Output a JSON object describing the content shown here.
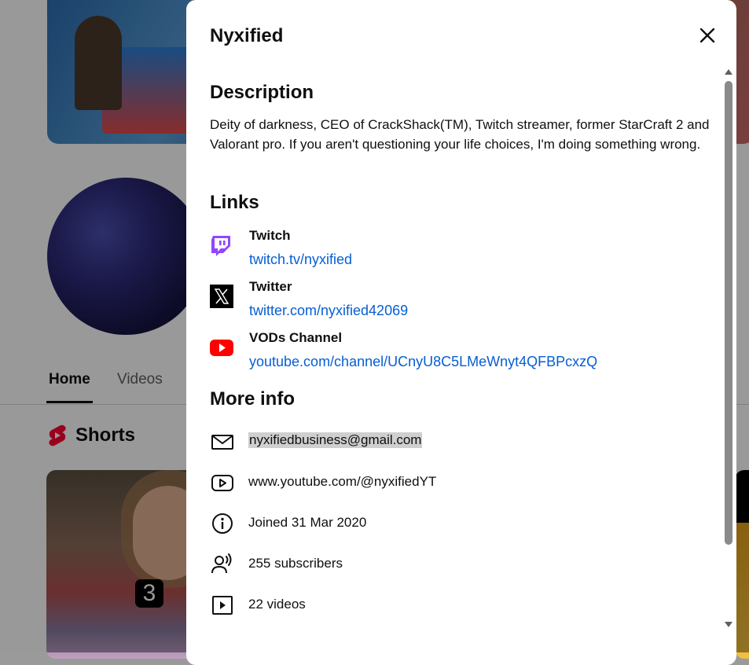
{
  "background": {
    "tabs": {
      "home": "Home",
      "videos": "Videos"
    },
    "shorts_title": "Shorts",
    "short_badge": "3"
  },
  "dialog": {
    "title": "Nyxified",
    "description_heading": "Description",
    "description": "Deity of darkness, CEO of CrackShack(TM), Twitch streamer, former StarCraft 2 and Valorant pro. If you aren't questioning your life choices, I'm doing something wrong.",
    "links_heading": "Links",
    "links": [
      {
        "name": "Twitch",
        "url": "twitch.tv/nyxified",
        "icon": "twitch-icon",
        "color": "#9146ff"
      },
      {
        "name": "Twitter",
        "url": "twitter.com/nyxified42069",
        "icon": "x-twitter-icon",
        "color": "#000000"
      },
      {
        "name": "VODs Channel",
        "url": "youtube.com/channel/UCnyU8C5LMeWnyt4QFBPcxzQ",
        "icon": "youtube-icon",
        "color": "#ff0000"
      }
    ],
    "more_info_heading": "More info",
    "more_info": [
      {
        "icon": "mail-icon",
        "text": "nyxifiedbusiness@gmail.com"
      },
      {
        "icon": "channel-url-icon",
        "text": "www.youtube.com/@nyxifiedYT"
      },
      {
        "icon": "info-icon",
        "text": "Joined 31 Mar 2020"
      },
      {
        "icon": "subscribers-icon",
        "text": "255 subscribers"
      },
      {
        "icon": "videos-icon",
        "text": "22 videos"
      }
    ]
  },
  "colors": {
    "link": "#065fd4",
    "text": "#0f0f0f",
    "shorts_red": "#ff0033"
  }
}
